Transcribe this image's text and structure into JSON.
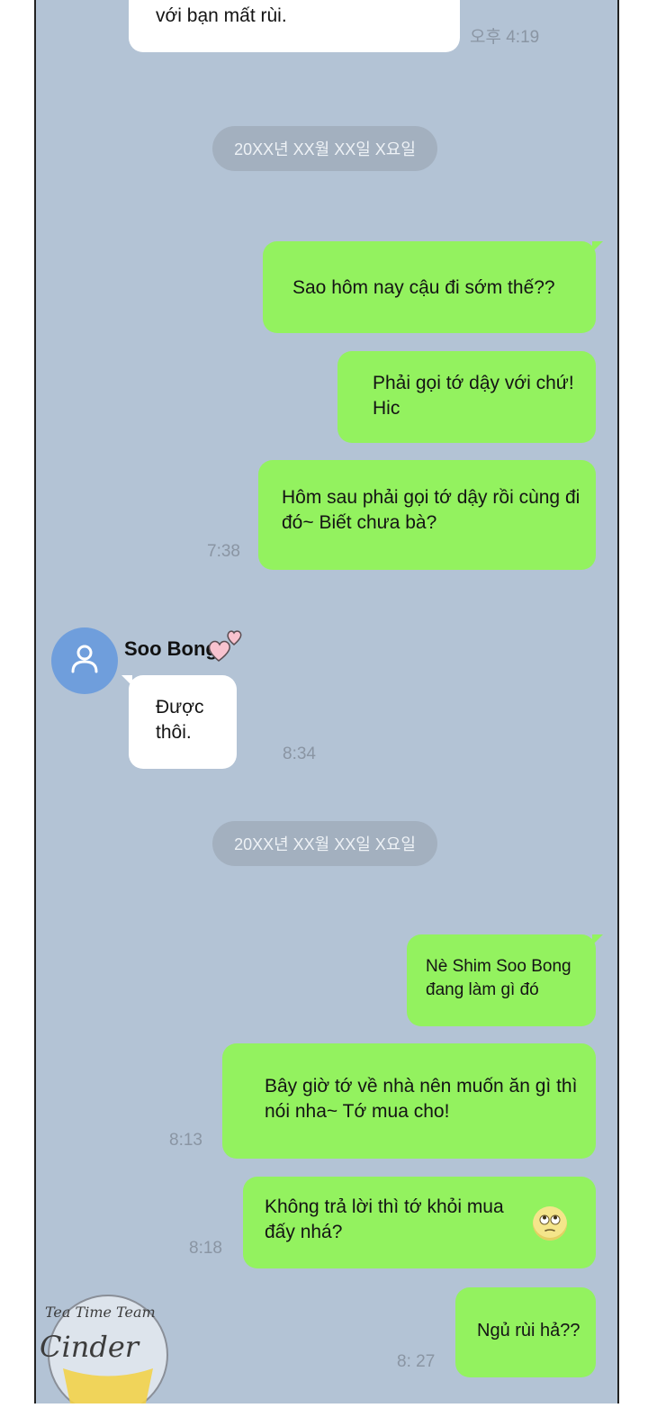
{
  "sender": {
    "name": "Soo Bong"
  },
  "date_separators": [
    "20XX년 XX월 XX일 X요일",
    "20XX년 XX월 XX일 X요일"
  ],
  "messages": [
    {
      "side": "in",
      "text": "với bạn mất rùi.",
      "time": "오후 4:19"
    },
    {
      "side": "out",
      "text": "Sao hôm nay cậu đi sớm thế??",
      "time": ""
    },
    {
      "side": "out",
      "text": "Phải gọi tớ dậy với chứ! Hic",
      "time": ""
    },
    {
      "side": "out",
      "text": "Hôm sau phải gọi tớ dậy rồi cùng đi đó~ Biết chưa bà?",
      "time": "7:38"
    },
    {
      "side": "in",
      "text": "Được thôi.",
      "time": "8:34"
    },
    {
      "side": "out",
      "text": "Nè Shim Soo Bong đang làm gì đó",
      "time": ""
    },
    {
      "side": "out",
      "text": "Bây giờ tớ về nhà nên muốn ăn gì thì nói nha~ Tớ mua cho!",
      "time": "8:13"
    },
    {
      "side": "out",
      "text": "Không trả lời thì tớ khỏi mua đấy nhá?",
      "time": "8:18"
    },
    {
      "side": "out",
      "text": "Ngủ rùi hả??",
      "time": "8: 27"
    }
  ],
  "icons": {
    "avatar": "person-icon",
    "sender_decoration": "hearts-icon",
    "emoji": "rolling-eyes-emoji-icon"
  },
  "watermark": {
    "text_top": "Tea Time Team",
    "text_main": "Cinder"
  },
  "colors": {
    "background": "#b3c3d5",
    "outgoing_bubble": "#93f25f",
    "incoming_bubble": "#ffffff",
    "avatar": "#6f9edc"
  }
}
